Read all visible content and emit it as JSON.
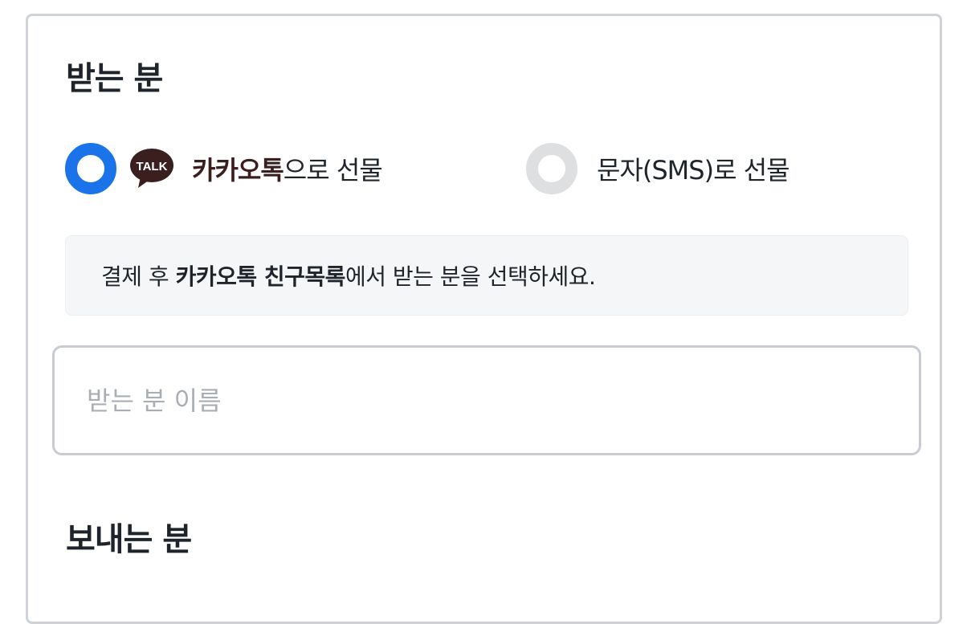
{
  "recipient_section": {
    "title": "받는 분"
  },
  "delivery_options": {
    "kakao": {
      "checked": true,
      "icon_text": "TALK",
      "label_bold": "카카오톡",
      "label_rest": "으로 선물"
    },
    "sms": {
      "checked": false,
      "label": "문자(SMS)로 선물"
    }
  },
  "info_box": {
    "prefix": "결제 후 ",
    "bold": "카카오톡 친구목록",
    "suffix": "에서 받는 분을 선택하세요."
  },
  "recipient_name": {
    "value": "",
    "placeholder": "받는 분 이름"
  },
  "sender_section": {
    "title": "보내는 분"
  },
  "colors": {
    "accent": "#1a73e8",
    "kakao_brown": "#3b1e1e",
    "unchecked_ring": "#dedfe1",
    "info_bg": "#f5f6f7"
  }
}
